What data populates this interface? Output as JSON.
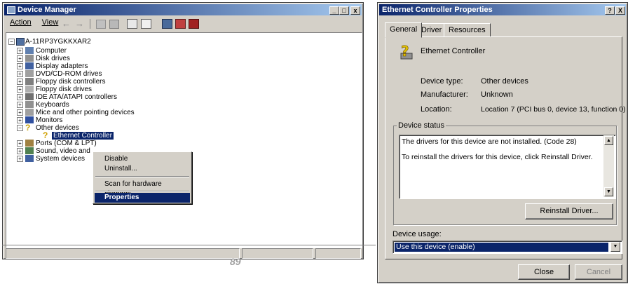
{
  "device_manager": {
    "title": "Device Manager",
    "menu": {
      "action": "Action",
      "view": "View"
    },
    "tree": {
      "root": "A-11RP3YGKKXAR2",
      "items": [
        "Computer",
        "Disk drives",
        "Display adapters",
        "DVD/CD-ROM drives",
        "Floppy disk controllers",
        "Floppy disk drives",
        "IDE ATA/ATAPI controllers",
        "Keyboards",
        "Mice and other pointing devices",
        "Monitors",
        "Other devices",
        "Ethernet Controller",
        "Ports (COM & LPT)",
        "Sound, video and",
        "System devices"
      ]
    },
    "context_menu": {
      "disable": "Disable",
      "uninstall": "Uninstall...",
      "scan": "Scan for hardware changes",
      "properties": "Properties"
    }
  },
  "page_number": "89",
  "properties": {
    "title": "Ethernet Controller Properties",
    "help": "?",
    "close_x": "X",
    "tabs": [
      "General",
      "Driver",
      "Resources"
    ],
    "device_name": "Ethernet Controller",
    "fields": {
      "type_label": "Device type:",
      "type_value": "Other devices",
      "manufacturer_label": "Manufacturer:",
      "manufacturer_value": "Unknown",
      "location_label": "Location:",
      "location_value": "Location 7 (PCI bus 0, device 13, function 0)"
    },
    "status_group": "Device status",
    "status_line1": "The drivers for this device are not installed. (Code 28)",
    "status_line2": "To reinstall the drivers for this device, click Reinstall Driver.",
    "reinstall_button": "Reinstall Driver...",
    "usage_label": "Device usage:",
    "usage_value": "Use this device (enable)",
    "close_button": "Close",
    "cancel_button": "Cancel"
  }
}
